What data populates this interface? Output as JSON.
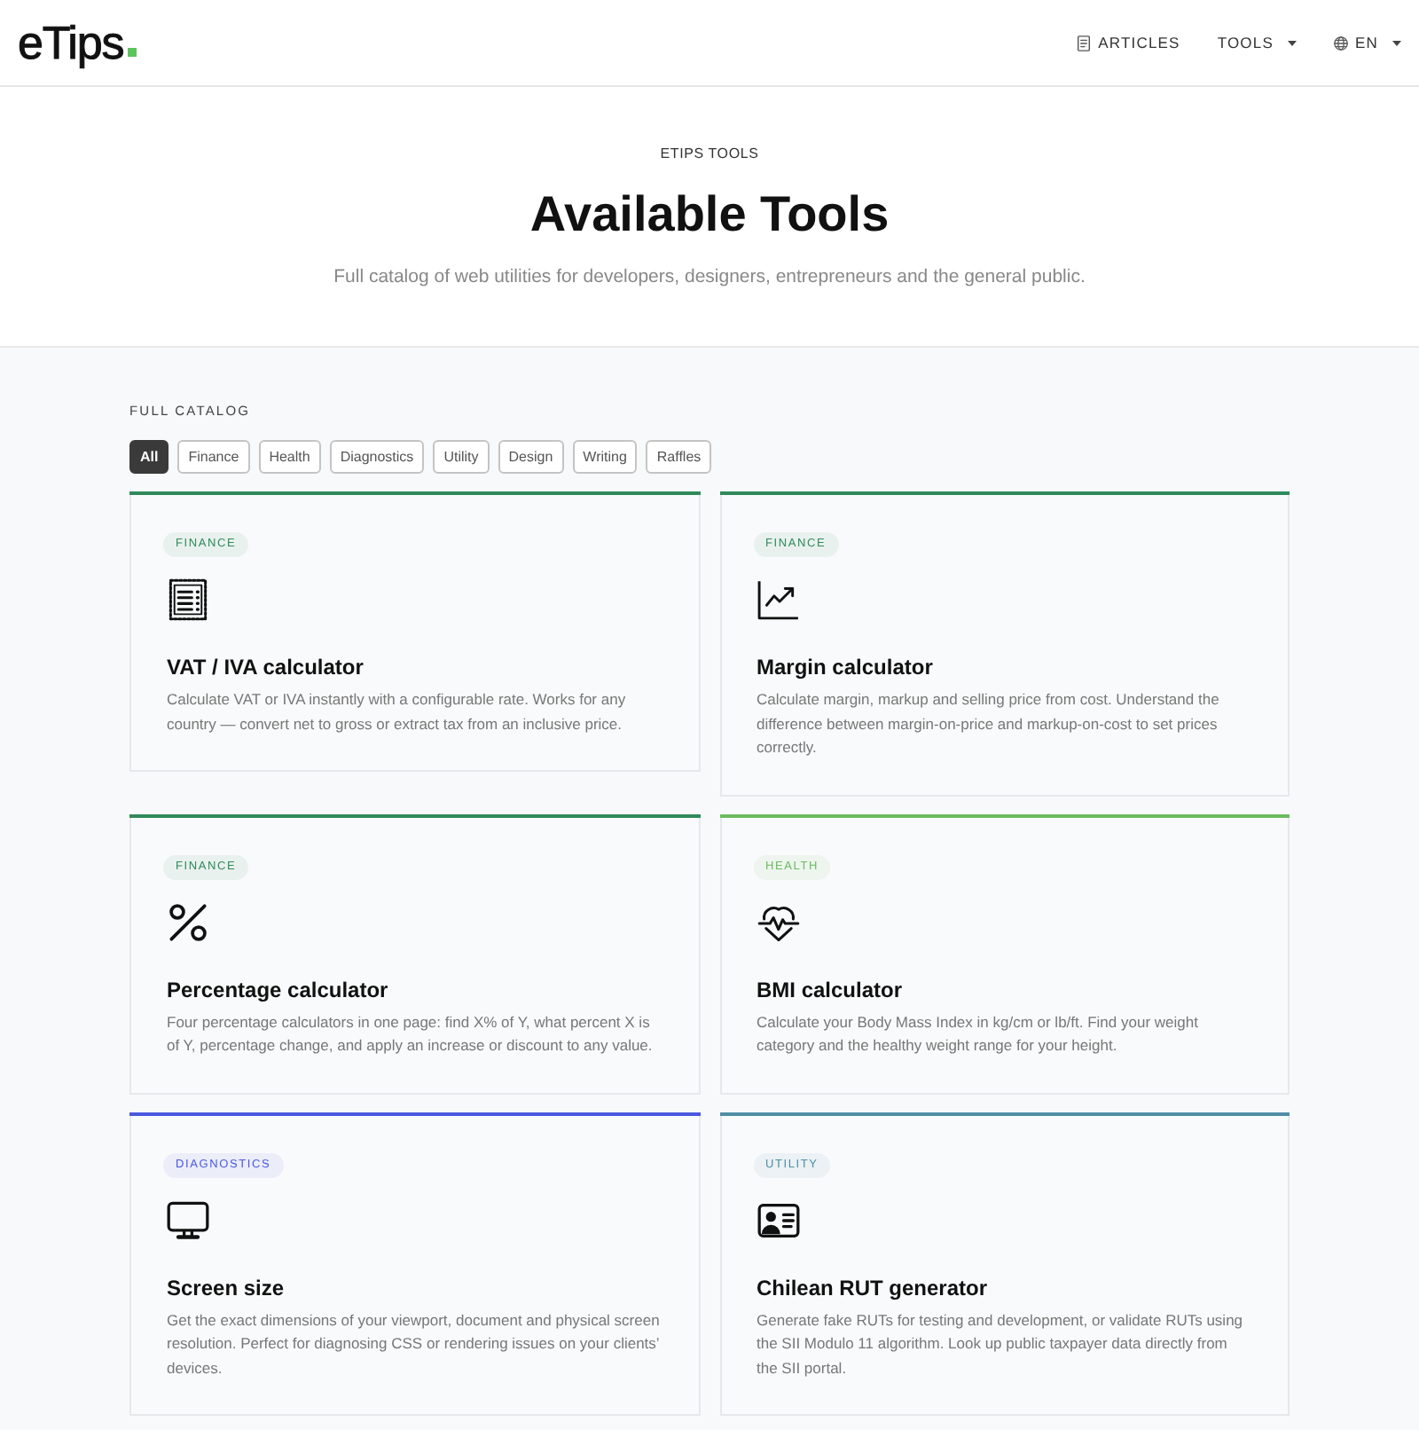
{
  "header": {
    "logo": "eTips",
    "nav": [
      {
        "kind": "link",
        "label": "ARTICLES"
      },
      {
        "kind": "menu",
        "label": "TOOLS"
      },
      {
        "kind": "language",
        "label": "EN"
      }
    ]
  },
  "hero": {
    "eyebrow": "ETIPS TOOLS",
    "title": "Available Tools",
    "subtitle": "Full catalog of web utilities for developers, designers, entrepreneurs and the general public."
  },
  "catalog": {
    "label": "FULL CATALOG",
    "filters": [
      {
        "label": "All",
        "selected": true
      },
      {
        "label": "Finance",
        "selected": false
      },
      {
        "label": "Health",
        "selected": false
      },
      {
        "label": "Diagnostics",
        "selected": false
      },
      {
        "label": "Utility",
        "selected": false
      },
      {
        "label": "Design",
        "selected": false
      },
      {
        "label": "Writing",
        "selected": false
      },
      {
        "label": "Raffles",
        "selected": false
      }
    ],
    "cards": [
      {
        "category": "FINANCE",
        "color": "#2f8a5a",
        "title": "VAT / IVA calculator",
        "description": "Calculate VAT or IVA instantly with a configurable rate. Works for any country — convert net to gross or extract tax from an inclusive price."
      },
      {
        "category": "FINANCE",
        "color": "#2f8a5a",
        "title": "Margin calculator",
        "description": "Calculate margin, markup and selling price from cost. Understand the difference between margin-on-price and markup-on-cost to set prices correctly."
      },
      {
        "category": "FINANCE",
        "color": "#2f8a5a",
        "title": "Percentage calculator",
        "description": "Four percentage calculators in one page: find X% of Y, what percent X is of Y, percentage change, and apply an increase or discount to any value."
      },
      {
        "category": "HEALTH",
        "color": "#6cbb5f",
        "title": "BMI calculator",
        "description": "Calculate your Body Mass Index in kg/cm or lb/ft. Find your weight category and the healthy weight range for your height."
      },
      {
        "category": "DIAGNOSTICS",
        "color": "#4a58e0",
        "title": "Screen size",
        "description": "Get the exact dimensions of your viewport, document and physical screen resolution. Perfect for diagnosing CSS or rendering issues on your clients’ devices."
      },
      {
        "category": "UTILITY",
        "color": "#4f8ea6",
        "title": "Chilean RUT generator",
        "description": "Generate fake RUTs for testing and development, or validate RUTs using the SII Modulo 11 algorithm. Look up public taxpayer data directly from the SII portal."
      }
    ]
  }
}
